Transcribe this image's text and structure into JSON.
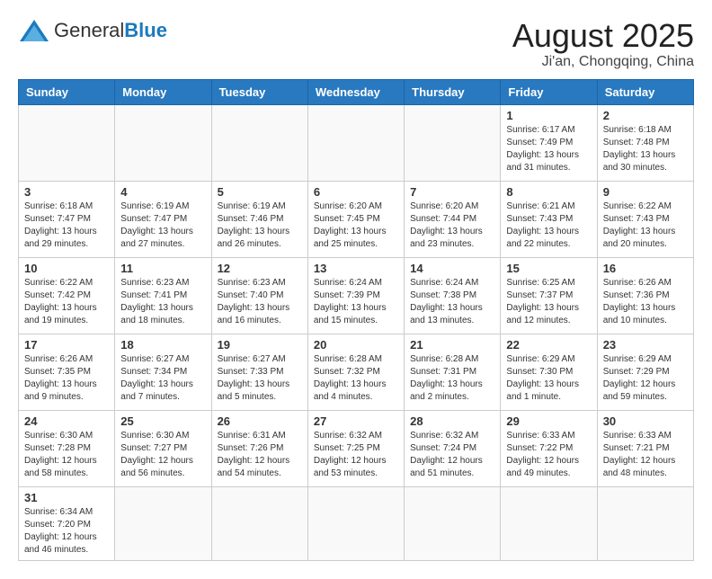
{
  "header": {
    "logo_general": "General",
    "logo_blue": "Blue",
    "month_title": "August 2025",
    "location": "Ji'an, Chongqing, China"
  },
  "weekdays": [
    "Sunday",
    "Monday",
    "Tuesday",
    "Wednesday",
    "Thursday",
    "Friday",
    "Saturday"
  ],
  "days": [
    {
      "date": "",
      "info": ""
    },
    {
      "date": "",
      "info": ""
    },
    {
      "date": "",
      "info": ""
    },
    {
      "date": "",
      "info": ""
    },
    {
      "date": "",
      "info": ""
    },
    {
      "date": "1",
      "info": "Sunrise: 6:17 AM\nSunset: 7:49 PM\nDaylight: 13 hours\nand 31 minutes."
    },
    {
      "date": "2",
      "info": "Sunrise: 6:18 AM\nSunset: 7:48 PM\nDaylight: 13 hours\nand 30 minutes."
    },
    {
      "date": "3",
      "info": "Sunrise: 6:18 AM\nSunset: 7:47 PM\nDaylight: 13 hours\nand 29 minutes."
    },
    {
      "date": "4",
      "info": "Sunrise: 6:19 AM\nSunset: 7:47 PM\nDaylight: 13 hours\nand 27 minutes."
    },
    {
      "date": "5",
      "info": "Sunrise: 6:19 AM\nSunset: 7:46 PM\nDaylight: 13 hours\nand 26 minutes."
    },
    {
      "date": "6",
      "info": "Sunrise: 6:20 AM\nSunset: 7:45 PM\nDaylight: 13 hours\nand 25 minutes."
    },
    {
      "date": "7",
      "info": "Sunrise: 6:20 AM\nSunset: 7:44 PM\nDaylight: 13 hours\nand 23 minutes."
    },
    {
      "date": "8",
      "info": "Sunrise: 6:21 AM\nSunset: 7:43 PM\nDaylight: 13 hours\nand 22 minutes."
    },
    {
      "date": "9",
      "info": "Sunrise: 6:22 AM\nSunset: 7:43 PM\nDaylight: 13 hours\nand 20 minutes."
    },
    {
      "date": "10",
      "info": "Sunrise: 6:22 AM\nSunset: 7:42 PM\nDaylight: 13 hours\nand 19 minutes."
    },
    {
      "date": "11",
      "info": "Sunrise: 6:23 AM\nSunset: 7:41 PM\nDaylight: 13 hours\nand 18 minutes."
    },
    {
      "date": "12",
      "info": "Sunrise: 6:23 AM\nSunset: 7:40 PM\nDaylight: 13 hours\nand 16 minutes."
    },
    {
      "date": "13",
      "info": "Sunrise: 6:24 AM\nSunset: 7:39 PM\nDaylight: 13 hours\nand 15 minutes."
    },
    {
      "date": "14",
      "info": "Sunrise: 6:24 AM\nSunset: 7:38 PM\nDaylight: 13 hours\nand 13 minutes."
    },
    {
      "date": "15",
      "info": "Sunrise: 6:25 AM\nSunset: 7:37 PM\nDaylight: 13 hours\nand 12 minutes."
    },
    {
      "date": "16",
      "info": "Sunrise: 6:26 AM\nSunset: 7:36 PM\nDaylight: 13 hours\nand 10 minutes."
    },
    {
      "date": "17",
      "info": "Sunrise: 6:26 AM\nSunset: 7:35 PM\nDaylight: 13 hours\nand 9 minutes."
    },
    {
      "date": "18",
      "info": "Sunrise: 6:27 AM\nSunset: 7:34 PM\nDaylight: 13 hours\nand 7 minutes."
    },
    {
      "date": "19",
      "info": "Sunrise: 6:27 AM\nSunset: 7:33 PM\nDaylight: 13 hours\nand 5 minutes."
    },
    {
      "date": "20",
      "info": "Sunrise: 6:28 AM\nSunset: 7:32 PM\nDaylight: 13 hours\nand 4 minutes."
    },
    {
      "date": "21",
      "info": "Sunrise: 6:28 AM\nSunset: 7:31 PM\nDaylight: 13 hours\nand 2 minutes."
    },
    {
      "date": "22",
      "info": "Sunrise: 6:29 AM\nSunset: 7:30 PM\nDaylight: 13 hours\nand 1 minute."
    },
    {
      "date": "23",
      "info": "Sunrise: 6:29 AM\nSunset: 7:29 PM\nDaylight: 12 hours\nand 59 minutes."
    },
    {
      "date": "24",
      "info": "Sunrise: 6:30 AM\nSunset: 7:28 PM\nDaylight: 12 hours\nand 58 minutes."
    },
    {
      "date": "25",
      "info": "Sunrise: 6:30 AM\nSunset: 7:27 PM\nDaylight: 12 hours\nand 56 minutes."
    },
    {
      "date": "26",
      "info": "Sunrise: 6:31 AM\nSunset: 7:26 PM\nDaylight: 12 hours\nand 54 minutes."
    },
    {
      "date": "27",
      "info": "Sunrise: 6:32 AM\nSunset: 7:25 PM\nDaylight: 12 hours\nand 53 minutes."
    },
    {
      "date": "28",
      "info": "Sunrise: 6:32 AM\nSunset: 7:24 PM\nDaylight: 12 hours\nand 51 minutes."
    },
    {
      "date": "29",
      "info": "Sunrise: 6:33 AM\nSunset: 7:22 PM\nDaylight: 12 hours\nand 49 minutes."
    },
    {
      "date": "30",
      "info": "Sunrise: 6:33 AM\nSunset: 7:21 PM\nDaylight: 12 hours\nand 48 minutes."
    },
    {
      "date": "31",
      "info": "Sunrise: 6:34 AM\nSunset: 7:20 PM\nDaylight: 12 hours\nand 46 minutes."
    },
    {
      "date": "",
      "info": ""
    },
    {
      "date": "",
      "info": ""
    },
    {
      "date": "",
      "info": ""
    },
    {
      "date": "",
      "info": ""
    },
    {
      "date": "",
      "info": ""
    },
    {
      "date": "",
      "info": ""
    }
  ]
}
